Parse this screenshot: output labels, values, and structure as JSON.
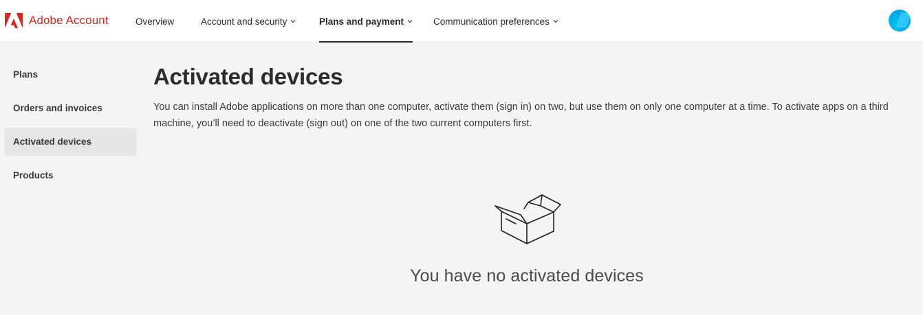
{
  "header": {
    "brand": "Adobe Account",
    "brand_color": "#e1251b",
    "nav": [
      {
        "label": "Overview",
        "has_dropdown": false,
        "active": false
      },
      {
        "label": "Account and security",
        "has_dropdown": true,
        "active": false
      },
      {
        "label": "Plans and payment",
        "has_dropdown": true,
        "active": true
      },
      {
        "label": "Communication preferences",
        "has_dropdown": true,
        "active": false
      }
    ],
    "avatar_icon": "user-avatar"
  },
  "sidebar": {
    "items": [
      {
        "label": "Plans",
        "active": false
      },
      {
        "label": "Orders and invoices",
        "active": false
      },
      {
        "label": "Activated devices",
        "active": true
      },
      {
        "label": "Products",
        "active": false
      }
    ]
  },
  "main": {
    "title": "Activated devices",
    "description": "You can install Adobe applications on more than one computer, activate them (sign in) on two, but use them on only one computer at a time. To activate apps on a third machine, you’ll need to deactivate (sign out) on one of the two current computers first.",
    "empty_icon": "open-box-icon",
    "empty_message": "You have no activated devices"
  }
}
